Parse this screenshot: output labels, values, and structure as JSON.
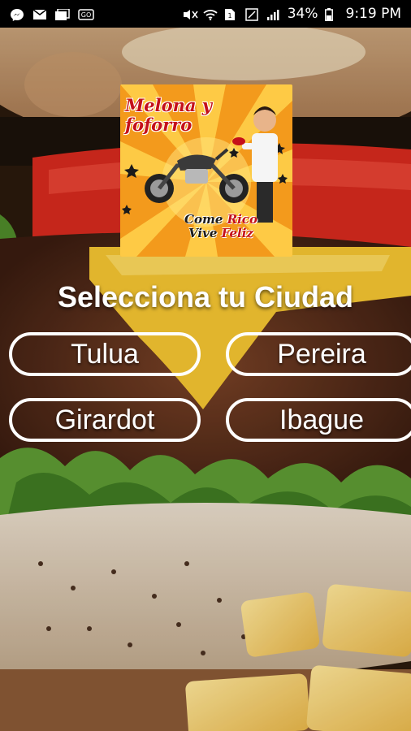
{
  "status_bar": {
    "battery": "34%",
    "time": "9:19 PM"
  },
  "logo": {
    "title": "Melona y\nfoforro",
    "slogan_part1": "Come",
    "slogan_part2": "Rico",
    "slogan_part3": "Vive",
    "slogan_part4": "Feliz"
  },
  "heading": "Selecciona tu Ciudad",
  "cities": {
    "tulua": "Tulua",
    "pereira": "Pereira",
    "girardot": "Girardot",
    "ibague": "Ibague"
  },
  "colors": {
    "logo_orange": "#f39a1c",
    "logo_red": "#c4101a",
    "button_border": "#ffffff"
  }
}
